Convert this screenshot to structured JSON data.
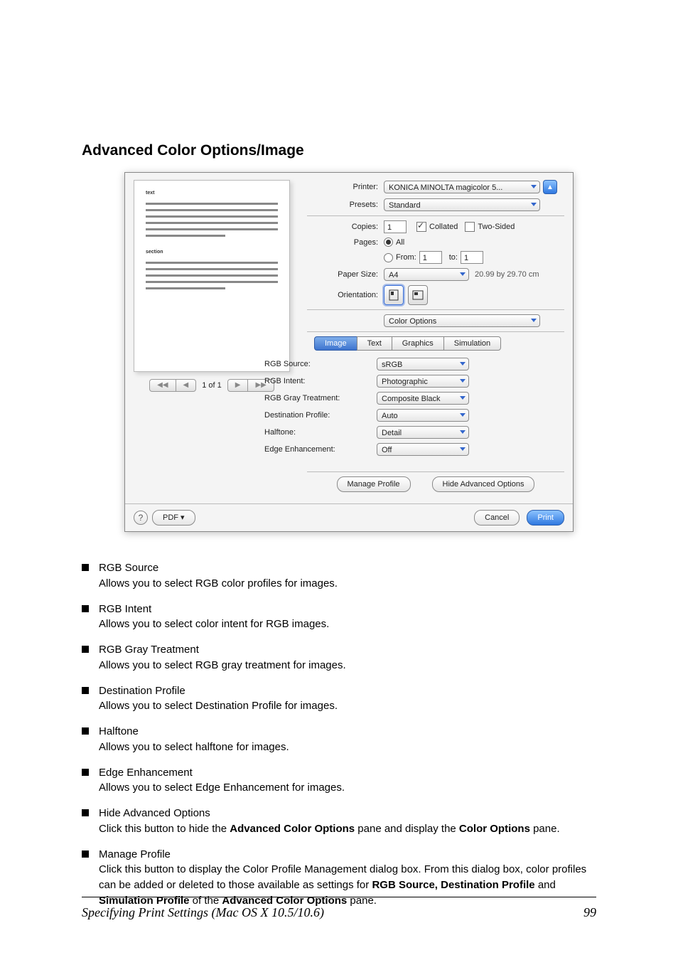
{
  "section_title": "Advanced Color Options/Image",
  "dialog": {
    "printer_label": "Printer:",
    "printer_value": "KONICA MINOLTA magicolor 5...",
    "presets_label": "Presets:",
    "presets_value": "Standard",
    "copies_label": "Copies:",
    "copies_value": "1",
    "collated": "Collated",
    "two_sided": "Two-Sided",
    "pages_label": "Pages:",
    "pages_all": "All",
    "pages_from": "From:",
    "pages_from_val": "1",
    "pages_to": "to:",
    "pages_to_val": "1",
    "paper_size_label": "Paper Size:",
    "paper_size_value": "A4",
    "paper_dim": "20.99 by 29.70 cm",
    "orientation_label": "Orientation:",
    "category_value": "Color Options",
    "tabs": [
      "Image",
      "Text",
      "Graphics",
      "Simulation"
    ],
    "options": [
      {
        "label": "RGB Source:",
        "value": "sRGB"
      },
      {
        "label": "RGB Intent:",
        "value": "Photographic"
      },
      {
        "label": "RGB Gray Treatment:",
        "value": "Composite Black"
      },
      {
        "label": "Destination Profile:",
        "value": "Auto"
      },
      {
        "label": "Halftone:",
        "value": "Detail"
      },
      {
        "label": "Edge Enhancement:",
        "value": "Off"
      }
    ],
    "manage_profile": "Manage Profile",
    "hide_adv": "Hide Advanced Options",
    "pdf": "PDF ▾",
    "cancel": "Cancel",
    "print": "Print",
    "pager_text": "1 of 1"
  },
  "bullets": [
    {
      "head": "RGB Source",
      "desc": "Allows you to select RGB color profiles for images."
    },
    {
      "head": "RGB Intent",
      "desc": "Allows you to select color intent for RGB images."
    },
    {
      "head": "RGB Gray Treatment",
      "desc": "Allows you to select RGB gray treatment for images."
    },
    {
      "head": "Destination Profile",
      "desc": "Allows you to select Destination Profile for images."
    },
    {
      "head": "Halftone",
      "desc": "Allows you to select halftone for images."
    },
    {
      "head": "Edge Enhancement",
      "desc": "Allows you to select Edge Enhancement for images."
    },
    {
      "head": "Hide Advanced Options",
      "desc": "Click this button to hide the <b>Advanced Color Options</b> pane and display the <b>Color Options</b> pane."
    },
    {
      "head": "Manage Profile",
      "desc": "Click this button to display the Color Profile Management dialog box. From this dialog box, color profiles can be added or deleted to those available as settings for <b>RGB Source, Destination Profile</b> and <b>Simulation Profile</b> of the <b>Advanced Color Options</b> pane."
    }
  ],
  "footer_left": "Specifying Print Settings (Mac OS X 10.5/10.6)",
  "footer_right": "99"
}
